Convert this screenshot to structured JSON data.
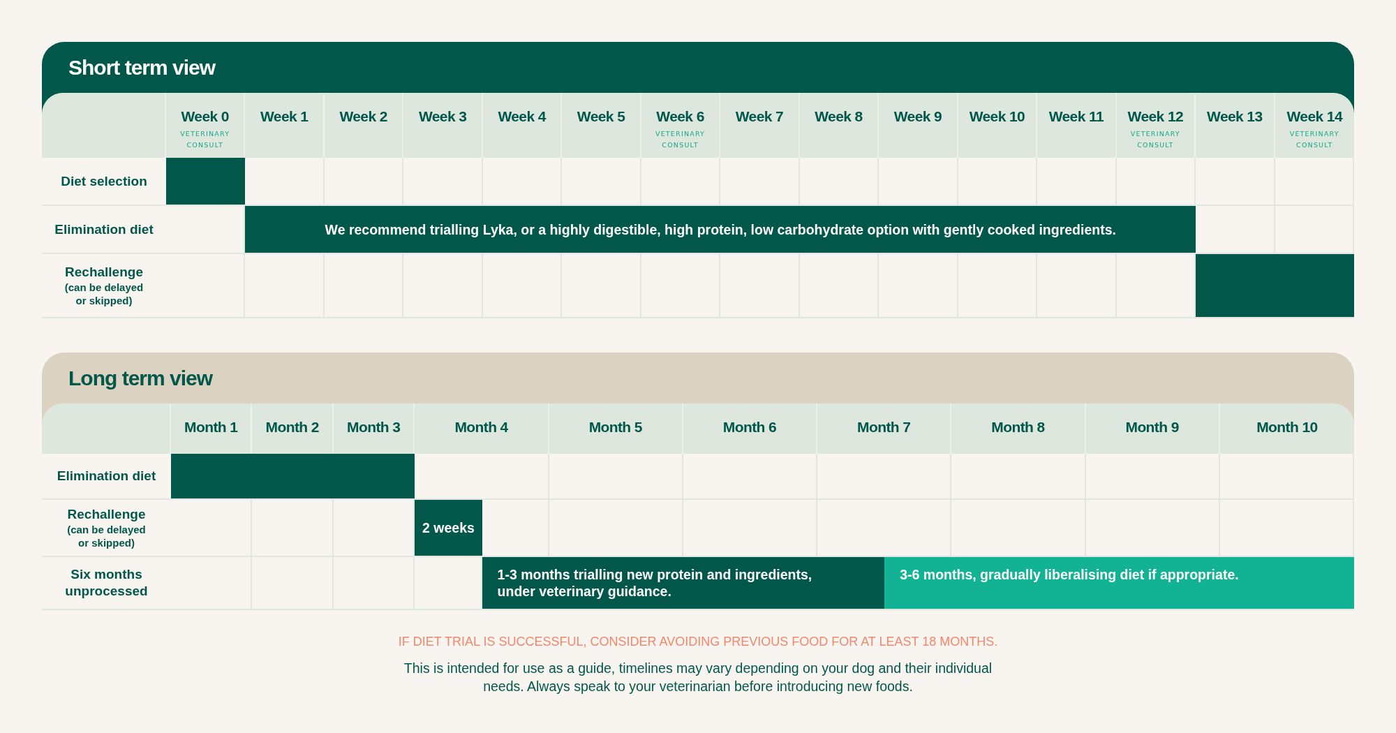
{
  "panels": [
    {
      "title": "Short term view",
      "color": "#00574a",
      "columns": [
        {
          "label": "Week 0",
          "note": "VETERINARY CONSULT"
        },
        {
          "label": "Week 1"
        },
        {
          "label": "Week 2"
        },
        {
          "label": "Week 3"
        },
        {
          "label": "Week 4"
        },
        {
          "label": "Week 5"
        },
        {
          "label": "Week 6",
          "note": "VETERINARY CONSULT"
        },
        {
          "label": "Week 7"
        },
        {
          "label": "Week 8"
        },
        {
          "label": "Week 9"
        },
        {
          "label": "Week 10"
        },
        {
          "label": "Week 11"
        },
        {
          "label": "Week 12",
          "note": "VETERINARY CONSULT"
        },
        {
          "label": "Week 13"
        },
        {
          "label": "Week 14",
          "note": "VETERINARY CONSULT"
        }
      ],
      "rows": [
        {
          "label": "Diet selection",
          "cells": [
            {
              "filled": true,
              "color": "#00574a"
            },
            {
              "filled": false
            },
            {
              "filled": false
            },
            {
              "filled": false
            },
            {
              "filled": false
            },
            {
              "filled": false
            },
            {
              "filled": false
            },
            {
              "filled": false
            },
            {
              "filled": false
            },
            {
              "filled": false
            },
            {
              "filled": false
            },
            {
              "filled": false
            },
            {
              "filled": false
            },
            {
              "filled": false
            },
            {
              "filled": false
            }
          ]
        },
        {
          "label": "Elimination diet",
          "cells": [
            {
              "filled": false
            },
            {
              "filled": true,
              "color": "#00574a"
            },
            {
              "filled": true,
              "color": "#00574a"
            },
            {
              "filled": true,
              "color": "#00574a"
            },
            {
              "filled": true,
              "color": "#00574a"
            },
            {
              "filled": true,
              "color": "#00574a"
            },
            {
              "filled": true,
              "color": "#00574a"
            },
            {
              "filled": true,
              "color": "#00574a"
            },
            {
              "filled": true,
              "color": "#00574a"
            },
            {
              "filled": true,
              "color": "#00574a"
            },
            {
              "filled": true,
              "color": "#00574a"
            },
            {
              "filled": true,
              "color": "#00574a"
            },
            {
              "filled": true,
              "color": "#00574a"
            },
            {
              "filled": false
            },
            {
              "filled": false
            }
          ],
          "bars": [
            "We recommend trialling Lyka, or a highly digestible, high protein, low carbohydrate option with gently cooked ingredients."
          ]
        },
        {
          "label": "Rechallenge",
          "note": "(can be delayed or skipped)",
          "cells": [
            {
              "filled": false
            },
            {
              "filled": false
            },
            {
              "filled": false
            },
            {
              "filled": false
            },
            {
              "filled": false
            },
            {
              "filled": false
            },
            {
              "filled": false
            },
            {
              "filled": false
            },
            {
              "filled": false
            },
            {
              "filled": false
            },
            {
              "filled": false
            },
            {
              "filled": false
            },
            {
              "filled": false
            },
            {
              "filled": true,
              "color": "#00574a"
            },
            {
              "filled": true,
              "color": "#00574a"
            }
          ]
        }
      ]
    },
    {
      "title": "Long term view",
      "color": "#dcd2c2",
      "columns": [
        {
          "label": "Month 1"
        },
        {
          "label": "Month 2"
        },
        {
          "label": "Month 3"
        },
        {
          "label": "Month 4"
        },
        {
          "label": "Month 5"
        },
        {
          "label": "Month 6"
        },
        {
          "label": "Month 7"
        },
        {
          "label": "Month 8"
        },
        {
          "label": "Month 9"
        },
        {
          "label": "Month 10"
        }
      ],
      "rows": [
        {
          "label": "Elimination diet",
          "cells": [
            {
              "filled": true,
              "color": "#00574a"
            },
            {
              "filled": true,
              "color": "#00574a"
            },
            {
              "filled": true,
              "color": "#00574a"
            },
            {
              "filled": false
            },
            {
              "filled": false
            },
            {
              "filled": false
            },
            {
              "filled": false
            },
            {
              "filled": false
            },
            {
              "filled": false
            },
            {
              "filled": false
            }
          ]
        },
        {
          "label": "Rechallenge",
          "note": "(can be delayed or skipped)",
          "cells": [
            {
              "filled": false
            },
            {
              "filled": false
            },
            {
              "filled": false
            },
            {
              "halves": [
                {
                  "filled": true,
                  "color": "#00574a"
                },
                {
                  "filled": false
                }
              ]
            },
            {
              "filled": false
            },
            {
              "filled": false
            },
            {
              "filled": false
            },
            {
              "filled": false
            },
            {
              "filled": false
            },
            {
              "filled": false
            }
          ],
          "bars": [
            "2 weeks"
          ]
        },
        {
          "label": "Six months unprocessed",
          "cells": [
            {
              "filled": false
            },
            {
              "filled": false
            },
            {
              "filled": false
            },
            {
              "halves": [
                {
                  "filled": false
                },
                {
                  "filled": true,
                  "color": "#00574a"
                }
              ]
            },
            {
              "filled": true,
              "color": "#00574a"
            },
            {
              "filled": true,
              "color": "#00574a"
            },
            {
              "halves": [
                {
                  "filled": true,
                  "color": "#00574a"
                },
                {
                  "filled": true,
                  "color": "#12b294"
                }
              ]
            },
            {
              "filled": true,
              "color": "#12b294"
            },
            {
              "filled": true,
              "color": "#12b294"
            },
            {
              "filled": true,
              "color": "#12b294"
            }
          ],
          "bars": [
            "1-3 months trialling new protein and ingredients, under veterinary guidance.",
            "3-6 months, gradually liberalising diet if appropriate."
          ]
        }
      ]
    }
  ],
  "footer": {
    "highlight": "IF DIET TRIAL IS SUCCESSFUL, CONSIDER AVOIDING PREVIOUS FOOD FOR AT LEAST 18 MONTHS.",
    "disclaimer": "This is intended for use as a guide, timelines may vary depending on your dog and their individual needs. Always speak to your veterinarian before introducing new foods."
  }
}
